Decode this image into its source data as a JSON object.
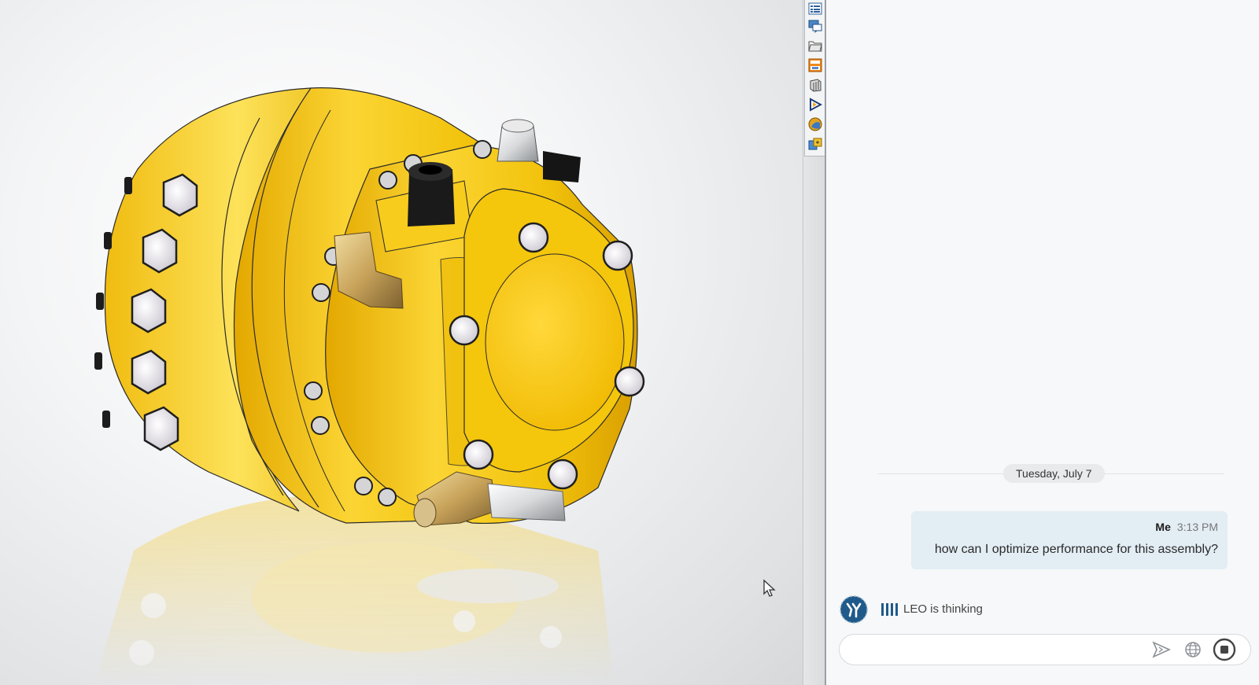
{
  "viewport": {
    "model_color": "#f6c90e",
    "background_color": "#e7e9eb"
  },
  "taskpane": {
    "tabs": [
      {
        "icon": "resources-icon"
      },
      {
        "icon": "forum-icon"
      },
      {
        "icon": "file-explorer-icon"
      },
      {
        "icon": "view-palette-icon"
      },
      {
        "icon": "design-library-icon"
      },
      {
        "icon": "leo-assistant-icon"
      },
      {
        "icon": "appearances-icon"
      },
      {
        "icon": "custom-properties-icon"
      }
    ]
  },
  "chat": {
    "date_separator": "Tuesday, July 7",
    "messages": [
      {
        "sender": "Me",
        "time": "3:13 PM",
        "text": "how can I optimize performance for this assembly?"
      }
    ],
    "status": "LEO is thinking",
    "input": {
      "value": "",
      "placeholder": ""
    },
    "colors": {
      "bubble": "#e3edf4",
      "accent": "#1f5a8a"
    },
    "buttons": {
      "send": "send-icon",
      "web": "globe-icon",
      "stop": "stop-icon"
    }
  }
}
